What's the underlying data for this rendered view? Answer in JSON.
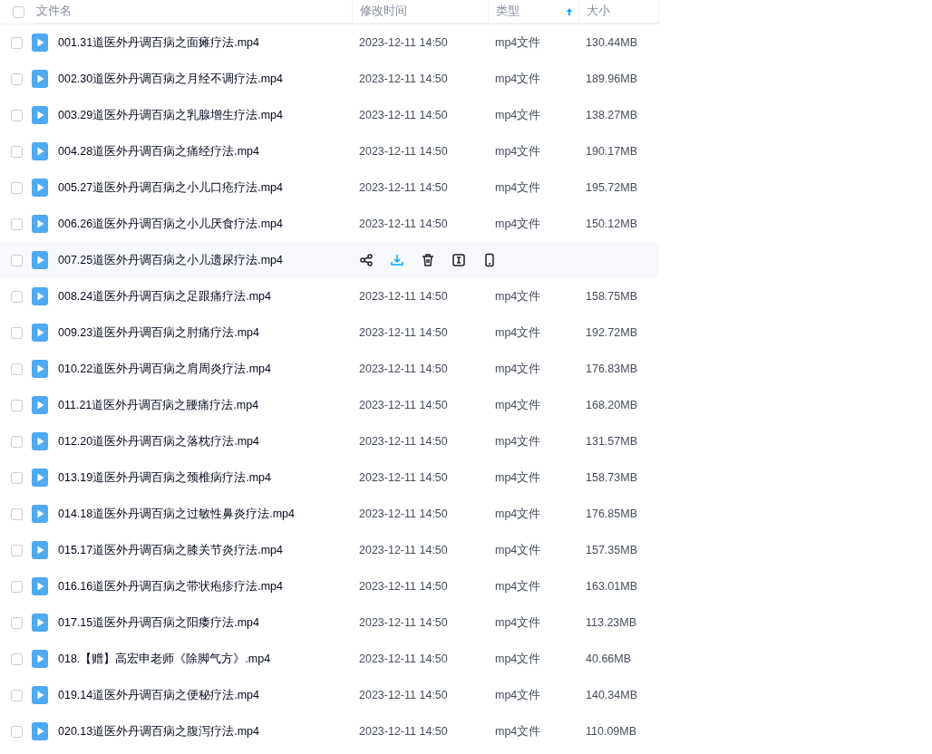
{
  "header": {
    "select_all_checked": false,
    "columns": [
      {
        "label": "文件名",
        "sorted": false
      },
      {
        "label": "修改时间",
        "sorted": false
      },
      {
        "label": "类型",
        "sorted": true
      },
      {
        "label": "大小",
        "sorted": false
      }
    ]
  },
  "rows": [
    {
      "name": "001.31道医外丹调百病之面瘫疗法.mp4",
      "modified": "2023-12-11 14:50",
      "type": "mp4文件",
      "size": "130.44MB",
      "checked": false,
      "hovered": false
    },
    {
      "name": "002.30道医外丹调百病之月经不调疗法.mp4",
      "modified": "2023-12-11 14:50",
      "type": "mp4文件",
      "size": "189.96MB",
      "checked": false,
      "hovered": false
    },
    {
      "name": "003.29道医外丹调百病之乳腺增生疗法.mp4",
      "modified": "2023-12-11 14:50",
      "type": "mp4文件",
      "size": "138.27MB",
      "checked": false,
      "hovered": false
    },
    {
      "name": "004.28道医外丹调百病之痛经疗法.mp4",
      "modified": "2023-12-11 14:50",
      "type": "mp4文件",
      "size": "190.17MB",
      "checked": false,
      "hovered": false
    },
    {
      "name": "005.27道医外丹调百病之小儿口疮疗法.mp4",
      "modified": "2023-12-11 14:50",
      "type": "mp4文件",
      "size": "195.72MB",
      "checked": false,
      "hovered": false
    },
    {
      "name": "006.26道医外丹调百病之小儿厌食疗法.mp4",
      "modified": "2023-12-11 14:50",
      "type": "mp4文件",
      "size": "150.12MB",
      "checked": false,
      "hovered": false
    },
    {
      "name": "007.25道医外丹调百病之小儿遗尿疗法.mp4",
      "checked": false,
      "hovered": true
    },
    {
      "name": "008.24道医外丹调百病之足跟痛疗法.mp4",
      "modified": "2023-12-11 14:50",
      "type": "mp4文件",
      "size": "158.75MB",
      "checked": false,
      "hovered": false
    },
    {
      "name": "009.23道医外丹调百病之肘痛疗法.mp4",
      "modified": "2023-12-11 14:50",
      "type": "mp4文件",
      "size": "192.72MB",
      "checked": false,
      "hovered": false
    },
    {
      "name": "010.22道医外丹调百病之肩周炎疗法.mp4",
      "modified": "2023-12-11 14:50",
      "type": "mp4文件",
      "size": "176.83MB",
      "checked": false,
      "hovered": false
    },
    {
      "name": "011.21道医外丹调百病之腰痛疗法.mp4",
      "modified": "2023-12-11 14:50",
      "type": "mp4文件",
      "size": "168.20MB",
      "checked": false,
      "hovered": false
    },
    {
      "name": "012.20道医外丹调百病之落枕疗法.mp4",
      "modified": "2023-12-11 14:50",
      "type": "mp4文件",
      "size": "131.57MB",
      "checked": false,
      "hovered": false
    },
    {
      "name": "013.19道医外丹调百病之颈椎病疗法.mp4",
      "modified": "2023-12-11 14:50",
      "type": "mp4文件",
      "size": "158.73MB",
      "checked": false,
      "hovered": false
    },
    {
      "name": "014.18道医外丹调百病之过敏性鼻炎疗法.mp4",
      "modified": "2023-12-11 14:50",
      "type": "mp4文件",
      "size": "176.85MB",
      "checked": false,
      "hovered": false
    },
    {
      "name": "015.17道医外丹调百病之膝关节炎疗法.mp4",
      "modified": "2023-12-11 14:50",
      "type": "mp4文件",
      "size": "157.35MB",
      "checked": false,
      "hovered": false
    },
    {
      "name": "016.16道医外丹调百病之带状疱疹疗法.mp4",
      "modified": "2023-12-11 14:50",
      "type": "mp4文件",
      "size": "163.01MB",
      "checked": false,
      "hovered": false
    },
    {
      "name": "017.15道医外丹调百病之阳痿疗法.mp4",
      "modified": "2023-12-11 14:50",
      "type": "mp4文件",
      "size": "113.23MB",
      "checked": false,
      "hovered": false
    },
    {
      "name": "018.【赠】高宏申老师《除脚气方》.mp4",
      "modified": "2023-12-11 14:50",
      "type": "mp4文件",
      "size": "40.66MB",
      "checked": false,
      "hovered": false
    },
    {
      "name": "019.14道医外丹调百病之便秘疗法.mp4",
      "modified": "2023-12-11 14:50",
      "type": "mp4文件",
      "size": "140.34MB",
      "checked": false,
      "hovered": false
    },
    {
      "name": "020.13道医外丹调百病之腹泻疗法.mp4",
      "modified": "2023-12-11 14:50",
      "type": "mp4文件",
      "size": "110.09MB",
      "checked": false,
      "hovered": false
    }
  ]
}
